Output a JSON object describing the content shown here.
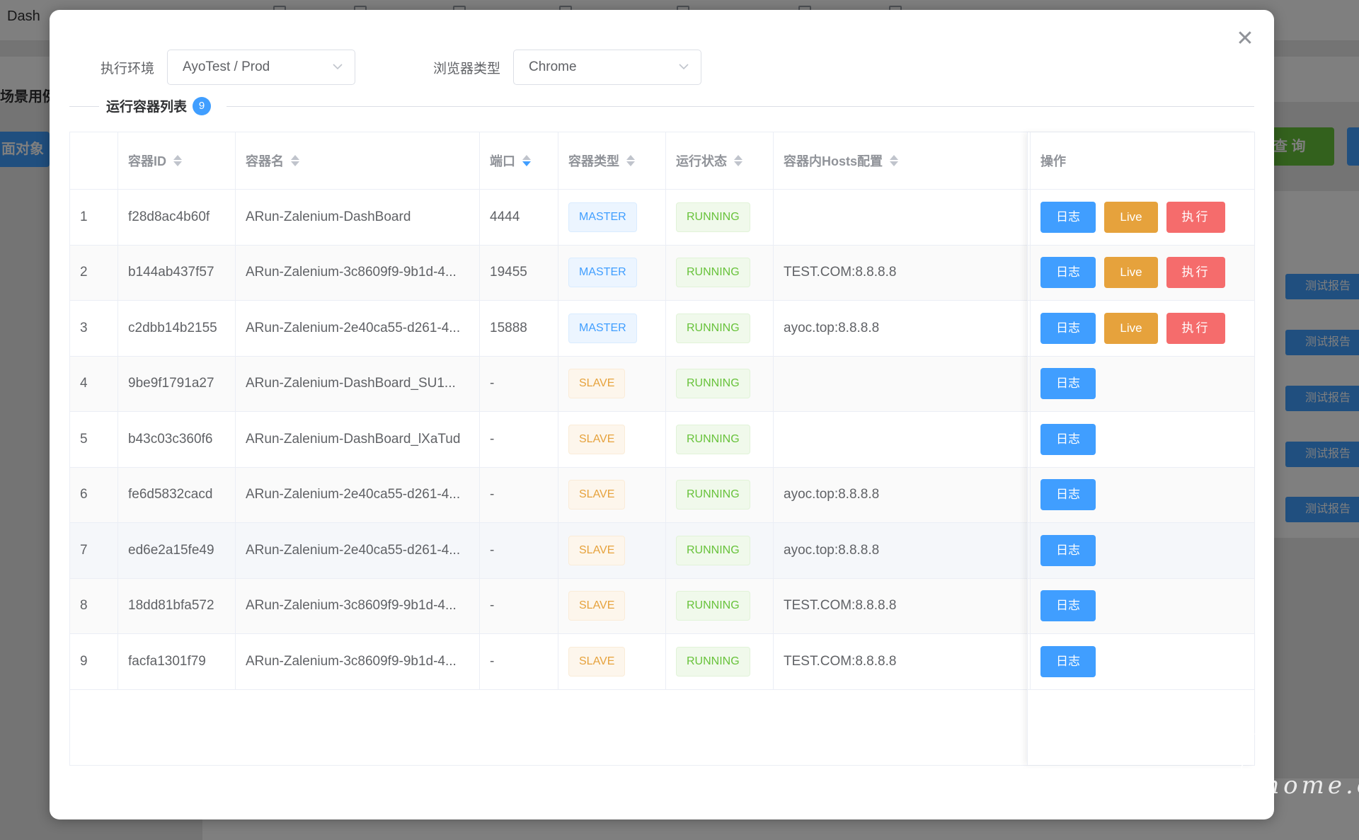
{
  "background": {
    "breadcrumb": "Dash",
    "section_label": "场景用例列",
    "left_button": "面对象",
    "query_button": "查 询",
    "report_buttons": [
      "测试报告",
      "测试报告",
      "测试报告",
      "测试报告",
      "测试报告"
    ]
  },
  "modal": {
    "close_icon": "close-icon",
    "env_label": "执行环境",
    "env_value": "AyoTest / Prod",
    "browser_label": "浏览器类型",
    "browser_value": "Chrome",
    "section_title": "运行容器列表",
    "section_count": "9"
  },
  "table": {
    "columns": [
      {
        "label": ""
      },
      {
        "label": "容器ID",
        "sort": "none"
      },
      {
        "label": "容器名",
        "sort": "none"
      },
      {
        "label": "端口",
        "sort": "desc"
      },
      {
        "label": "容器类型",
        "sort": "none"
      },
      {
        "label": "运行状态",
        "sort": "none"
      },
      {
        "label": "容器内Hosts配置",
        "sort": "none"
      },
      {
        "label": "操作"
      }
    ],
    "rows": [
      {
        "index": "1",
        "id": "f28d8ac4b60f",
        "name": "ARun-Zalenium-DashBoard",
        "port": "4444",
        "type": "MASTER",
        "status": "RUNNING",
        "hosts": "",
        "actions": [
          "日志",
          "Live",
          "执行"
        ]
      },
      {
        "index": "2",
        "id": "b144ab437f57",
        "name": "ARun-Zalenium-3c8609f9-9b1d-4...",
        "port": "19455",
        "type": "MASTER",
        "status": "RUNNING",
        "hosts": "TEST.COM:8.8.8.8",
        "actions": [
          "日志",
          "Live",
          "执行"
        ]
      },
      {
        "index": "3",
        "id": "c2dbb14b2155",
        "name": "ARun-Zalenium-2e40ca55-d261-4...",
        "port": "15888",
        "type": "MASTER",
        "status": "RUNNING",
        "hosts": "ayoc.top:8.8.8.8",
        "actions": [
          "日志",
          "Live",
          "执行"
        ]
      },
      {
        "index": "4",
        "id": "9be9f1791a27",
        "name": "ARun-Zalenium-DashBoard_SU1...",
        "port": "-",
        "type": "SLAVE",
        "status": "RUNNING",
        "hosts": "",
        "actions": [
          "日志"
        ]
      },
      {
        "index": "5",
        "id": "b43c03c360f6",
        "name": "ARun-Zalenium-DashBoard_lXaTud",
        "port": "-",
        "type": "SLAVE",
        "status": "RUNNING",
        "hosts": "",
        "actions": [
          "日志"
        ]
      },
      {
        "index": "6",
        "id": "fe6d5832cacd",
        "name": "ARun-Zalenium-2e40ca55-d261-4...",
        "port": "-",
        "type": "SLAVE",
        "status": "RUNNING",
        "hosts": "ayoc.top:8.8.8.8",
        "actions": [
          "日志"
        ]
      },
      {
        "index": "7",
        "id": "ed6e2a15fe49",
        "name": "ARun-Zalenium-2e40ca55-d261-4...",
        "port": "-",
        "type": "SLAVE",
        "status": "RUNNING",
        "hosts": "ayoc.top:8.8.8.8",
        "actions": [
          "日志"
        ]
      },
      {
        "index": "8",
        "id": "18dd81bfa572",
        "name": "ARun-Zalenium-3c8609f9-9b1d-4...",
        "port": "-",
        "type": "SLAVE",
        "status": "RUNNING",
        "hosts": "TEST.COM:8.8.8.8",
        "actions": [
          "日志"
        ]
      },
      {
        "index": "9",
        "id": "facfa1301f79",
        "name": "ARun-Zalenium-3c8609f9-9b1d-4...",
        "port": "-",
        "type": "SLAVE",
        "status": "RUNNING",
        "hosts": "TEST.COM:8.8.8.8",
        "actions": [
          "日志"
        ]
      }
    ]
  },
  "watermark": "testerhome.com",
  "colors": {
    "primary": "#409eff",
    "warning": "#e6a23c",
    "danger": "#f56c6c",
    "success": "#67c23a"
  }
}
